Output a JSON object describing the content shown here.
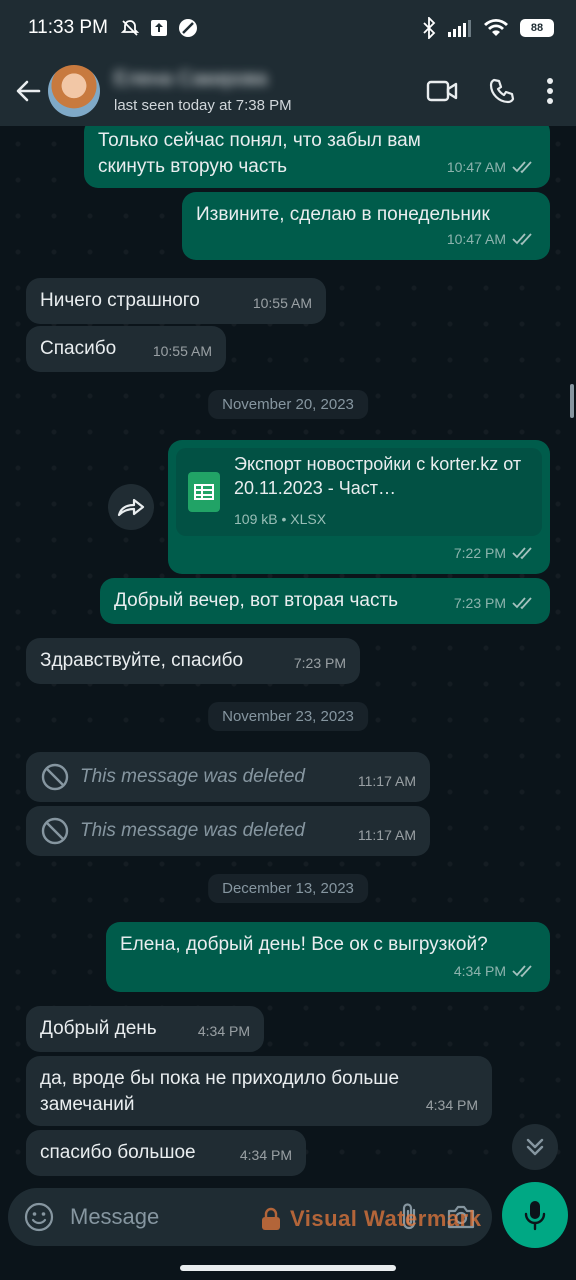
{
  "status_bar": {
    "time": "11:33 PM",
    "battery": "88",
    "icons": [
      "mute-icon",
      "upload-icon",
      "no-disturb-icon",
      "bluetooth-icon",
      "signal-icon",
      "wifi-icon",
      "battery-icon"
    ]
  },
  "header": {
    "contact_name": "Елена Сакирова",
    "last_seen": "last seen today at 7:38 PM",
    "icons": [
      "back-arrow-icon",
      "video-call-icon",
      "phone-icon",
      "more-vertical-icon"
    ]
  },
  "messages": [
    {
      "dir": "out",
      "text": "Только сейчас понял, что забыл вам скинуть вторую часть",
      "time": "10:47 AM"
    },
    {
      "dir": "out",
      "text": "Извините, сделаю в понедельник",
      "time": "10:47 AM"
    },
    {
      "dir": "in",
      "text": "Ничего страшного",
      "time": "10:55 AM"
    },
    {
      "dir": "in",
      "text": "Спасибо",
      "time": "10:55 AM"
    },
    {
      "dir": "out",
      "type": "file",
      "file_name": "Экспорт новостройки с korter.kz от 20.11.2023 - Част…",
      "file_info": "109 kB • XLSX",
      "time": "7:22 PM"
    },
    {
      "dir": "out",
      "text": "Добрый вечер, вот вторая часть",
      "time": "7:23 PM"
    },
    {
      "dir": "in",
      "text": "Здравствуйте, спасибо",
      "time": "7:23 PM"
    },
    {
      "dir": "in",
      "type": "deleted",
      "text": "This message was deleted",
      "time": "11:17 AM"
    },
    {
      "dir": "in",
      "type": "deleted",
      "text": "This message was deleted",
      "time": "11:17 AM"
    },
    {
      "dir": "out",
      "text": "Елена, добрый день! Все ок с выгрузкой?",
      "time": "4:34 PM"
    },
    {
      "dir": "in",
      "text": "Добрый день",
      "time": "4:34 PM"
    },
    {
      "dir": "in",
      "text": "да, вроде бы пока не приходило больше замечаний",
      "time": "4:34 PM"
    },
    {
      "dir": "in",
      "text": "спасибо большое",
      "time": "4:34 PM"
    }
  ],
  "date_separators": [
    "November 20, 2023",
    "November 23, 2023",
    "December 13, 2023"
  ],
  "composer": {
    "placeholder": "Message",
    "icons": [
      "emoji-icon",
      "attach-icon",
      "camera-icon",
      "mic-icon"
    ]
  },
  "watermark": "Visual Watermark",
  "colors": {
    "background": "#0b141a",
    "bar": "#1f2c33",
    "outgoing_bubble": "#005c4b",
    "incoming_bubble": "#202c33",
    "accent": "#00a884",
    "xlsx_icon": "#21a366"
  }
}
